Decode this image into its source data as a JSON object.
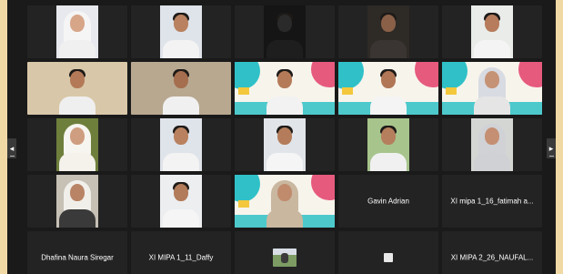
{
  "meeting": {
    "tiles": [
      {
        "name": "",
        "type": "video",
        "variant": "hijab-white"
      },
      {
        "name": "",
        "type": "video",
        "variant": "boy-white"
      },
      {
        "name": "",
        "type": "video",
        "variant": "dark"
      },
      {
        "name": "",
        "type": "video",
        "variant": "boy-dark"
      },
      {
        "name": "",
        "type": "video",
        "variant": "boy-white-window"
      },
      {
        "name": "",
        "type": "video",
        "variant": "boy-room"
      },
      {
        "name": "",
        "type": "video",
        "variant": "boy-shelf"
      },
      {
        "name": "",
        "type": "video",
        "variant": "poster-boy"
      },
      {
        "name": "",
        "type": "video",
        "variant": "poster-boy2"
      },
      {
        "name": "",
        "type": "video",
        "variant": "poster-hijab"
      },
      {
        "name": "",
        "type": "video",
        "variant": "hijab-green-bg"
      },
      {
        "name": "",
        "type": "video",
        "variant": "boy-white"
      },
      {
        "name": "",
        "type": "video",
        "variant": "boy-white2"
      },
      {
        "name": "",
        "type": "video",
        "variant": "boy-green"
      },
      {
        "name": "",
        "type": "video",
        "variant": "hijab-grey"
      },
      {
        "name": "",
        "type": "video",
        "variant": "hijab-dark"
      },
      {
        "name": "",
        "type": "video",
        "variant": "boy-white3"
      },
      {
        "name": "",
        "type": "video",
        "variant": "poster-hijab-wide"
      },
      {
        "name": "Gavin Adrian",
        "type": "name"
      },
      {
        "name": "XI mipa 1_16_fatimah a...",
        "type": "name"
      },
      {
        "name": "Dhafina Naura Siregar",
        "type": "name"
      },
      {
        "name": "XI MIPA 1_11_Daffy",
        "type": "name"
      },
      {
        "name": "",
        "type": "thumb"
      },
      {
        "name": "",
        "type": "square"
      },
      {
        "name": "XI MIPA 2_26_NAUFAL...",
        "type": "name"
      }
    ]
  },
  "nav": {
    "prev_icon": "◂",
    "next_icon": "▸"
  },
  "colors": {
    "frame": "#1a1a1a",
    "tile": "#232323",
    "outer": "#f1d9a6",
    "poster_teal": "#2fc1c7",
    "poster_pink": "#e65a7e",
    "poster_yellow": "#f3c83d"
  }
}
